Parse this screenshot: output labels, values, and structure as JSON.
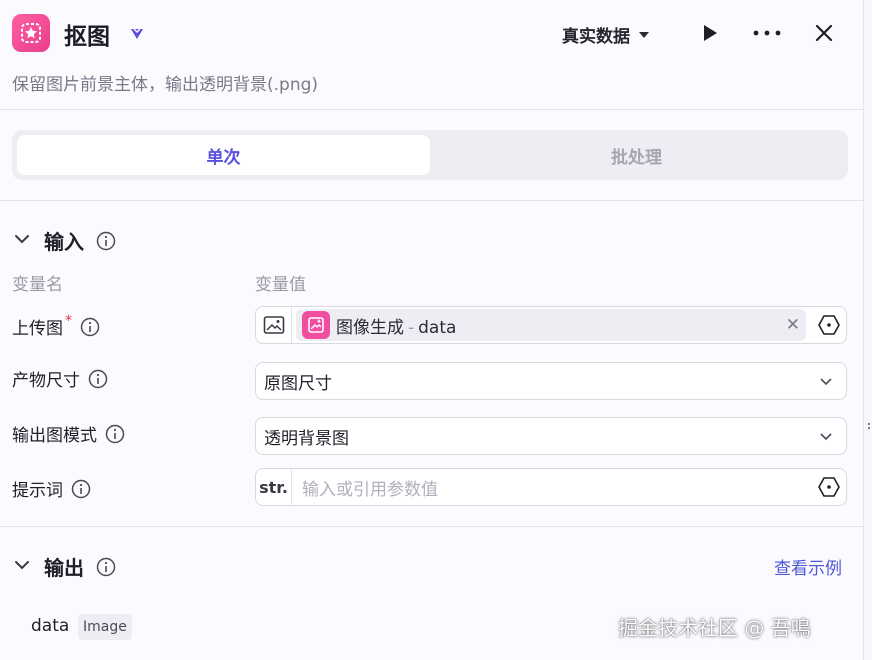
{
  "header": {
    "title": "抠图",
    "subtitle": "保留图片前景主体，输出透明背景(.png)",
    "data_mode": "真实数据"
  },
  "tabs": [
    {
      "label": "单次",
      "active": true
    },
    {
      "label": "批处理",
      "active": false
    }
  ],
  "input": {
    "section_title": "输入",
    "col_name": "变量名",
    "col_value": "变量值",
    "rows": {
      "upload": {
        "label": "上传图",
        "required_mark": "*",
        "tag_source": "图像生成",
        "tag_sep": "-",
        "tag_field": "data"
      },
      "size": {
        "label": "产物尺寸",
        "value": "原图尺寸"
      },
      "mode": {
        "label": "输出图模式",
        "value": "透明背景图"
      },
      "prompt": {
        "label": "提示词",
        "prefix": "str.",
        "placeholder": "输入或引用参数值"
      }
    }
  },
  "output": {
    "section_title": "输出",
    "example_link": "查看示例",
    "field_name": "data",
    "field_type": "Image"
  },
  "watermark": "掘金技术社区 @ 吾鳴",
  "colors": {
    "accent": "#5a4ee0",
    "link": "#4f58d8",
    "brand_pink": "#f14ea0",
    "required": "#e0364b"
  }
}
